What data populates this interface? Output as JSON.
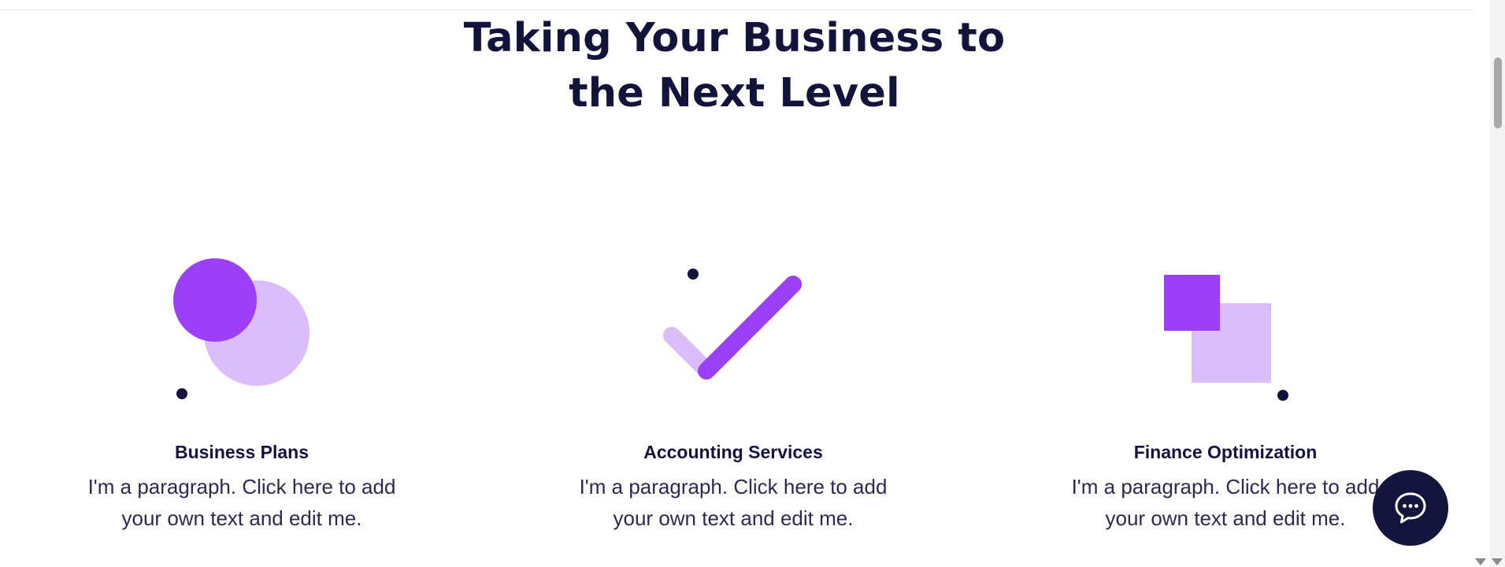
{
  "section": {
    "title_lines": [
      "Taking Your Business to",
      "the Next Level"
    ]
  },
  "features": [
    {
      "title": "Business Plans",
      "icon": "overlapping-circles-icon",
      "text_lines": [
        "I'm a paragraph. Click here to add",
        "your own text and edit me."
      ]
    },
    {
      "title": "Accounting Services",
      "icon": "checkmark-icon",
      "text_lines": [
        "I'm a paragraph. Click here to add",
        "your own text and edit me."
      ]
    },
    {
      "title": "Finance Optimization",
      "icon": "overlapping-squares-icon",
      "text_lines": [
        "I'm a paragraph. Click here to add",
        "your own text and edit me."
      ]
    }
  ],
  "chat": {
    "icon": "chat-bubble-icon"
  },
  "colors": {
    "navy": "#14133b",
    "purple": "#9b3ff9",
    "lavender": "#dbbdfb",
    "background": "#ffffff"
  }
}
